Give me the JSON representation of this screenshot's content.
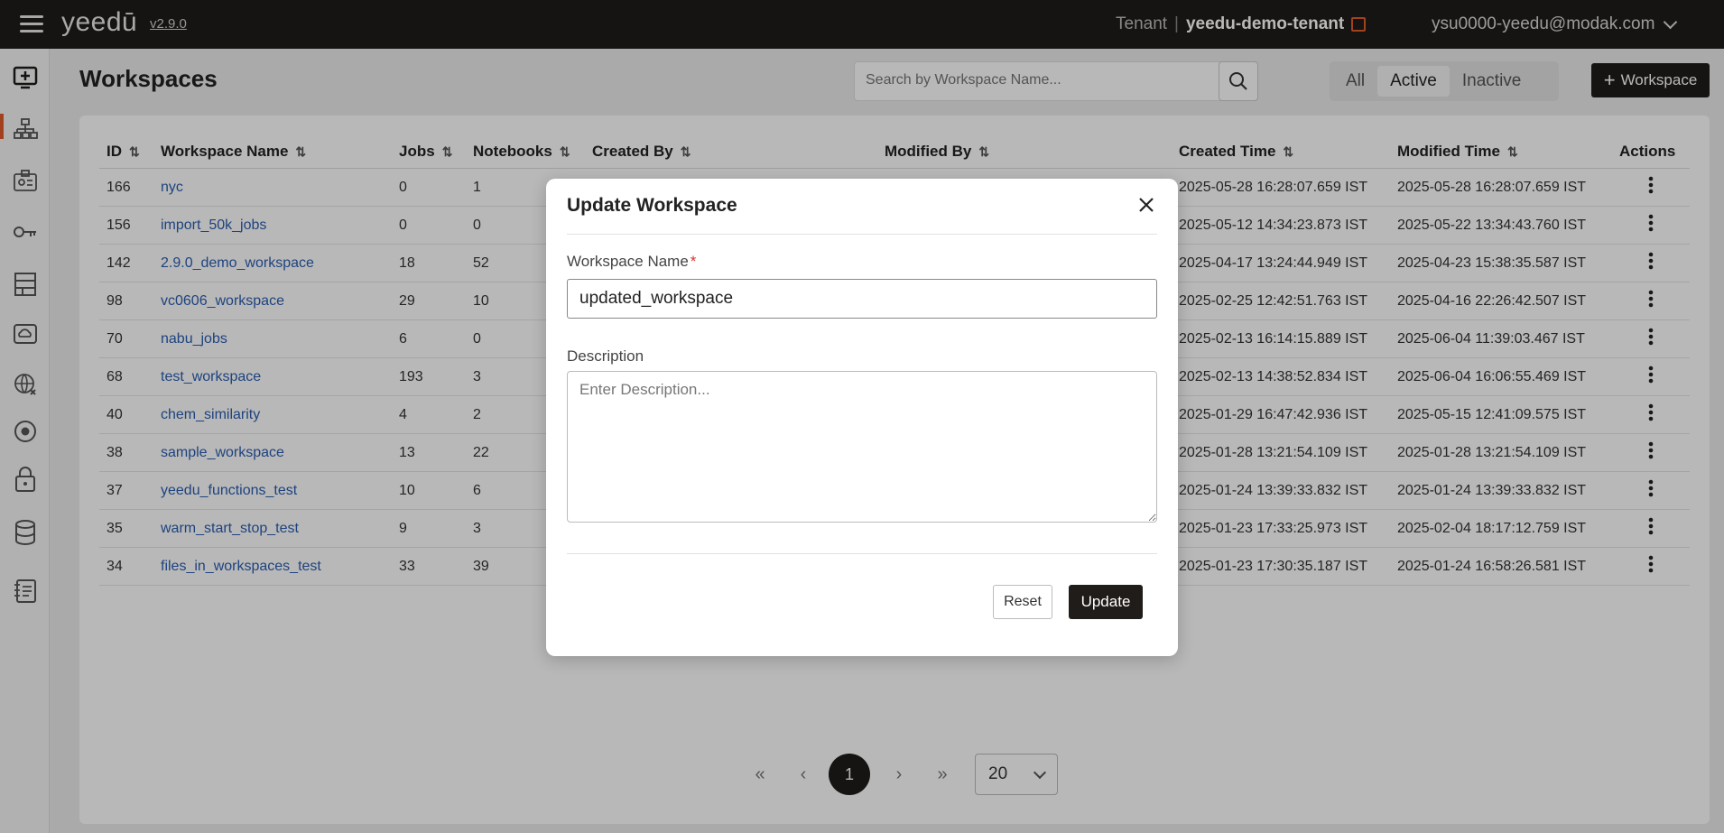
{
  "header": {
    "logo": "yeedū",
    "version": "v2.9.0",
    "tenant_label": "Tenant",
    "tenant_separator": "|",
    "tenant_name": "yeedu-demo-tenant",
    "user_email": "ysu0000-yeedu@modak.com"
  },
  "sidebar": {
    "icons": [
      "workspace-icon",
      "cluster-icon",
      "badge-icon",
      "key-icon",
      "building-icon",
      "cloud-icon",
      "globe-icon",
      "target-icon",
      "lock-icon",
      "database-icon",
      "notes-icon"
    ]
  },
  "page": {
    "title": "Workspaces",
    "search_placeholder": "Search by Workspace Name...",
    "filters": [
      "All",
      "Active",
      "Inactive"
    ],
    "active_filter": "Active",
    "add_button": "Workspace"
  },
  "table": {
    "columns": [
      "ID",
      "Workspace Name",
      "Jobs",
      "Notebooks",
      "Created By",
      "Modified By",
      "Created Time",
      "Modified Time",
      "Actions"
    ],
    "rows": [
      {
        "id": "166",
        "name": "nyc",
        "jobs": "0",
        "notebooks": "1",
        "created": "2025-05-28 16:28:07.659 IST",
        "modified": "2025-05-28 16:28:07.659 IST"
      },
      {
        "id": "156",
        "name": "import_50k_jobs",
        "jobs": "0",
        "notebooks": "0",
        "created": "2025-05-12 14:34:23.873 IST",
        "modified": "2025-05-22 13:34:43.760 IST"
      },
      {
        "id": "142",
        "name": "2.9.0_demo_workspace",
        "jobs": "18",
        "notebooks": "52",
        "created": "2025-04-17 13:24:44.949 IST",
        "modified": "2025-04-23 15:38:35.587 IST"
      },
      {
        "id": "98",
        "name": "vc0606_workspace",
        "jobs": "29",
        "notebooks": "10",
        "created": "2025-02-25 12:42:51.763 IST",
        "modified": "2025-04-16 22:26:42.507 IST"
      },
      {
        "id": "70",
        "name": "nabu_jobs",
        "jobs": "6",
        "notebooks": "0",
        "created": "2025-02-13 16:14:15.889 IST",
        "modified": "2025-06-04 11:39:03.467 IST"
      },
      {
        "id": "68",
        "name": "test_workspace",
        "jobs": "193",
        "notebooks": "3",
        "created": "2025-02-13 14:38:52.834 IST",
        "modified": "2025-06-04 16:06:55.469 IST"
      },
      {
        "id": "40",
        "name": "chem_similarity",
        "jobs": "4",
        "notebooks": "2",
        "created": "2025-01-29 16:47:42.936 IST",
        "modified": "2025-05-15 12:41:09.575 IST"
      },
      {
        "id": "38",
        "name": "sample_workspace",
        "jobs": "13",
        "notebooks": "22",
        "created": "2025-01-28 13:21:54.109 IST",
        "modified": "2025-01-28 13:21:54.109 IST"
      },
      {
        "id": "37",
        "name": "yeedu_functions_test",
        "jobs": "10",
        "notebooks": "6",
        "created": "2025-01-24 13:39:33.832 IST",
        "modified": "2025-01-24 13:39:33.832 IST"
      },
      {
        "id": "35",
        "name": "warm_start_stop_test",
        "jobs": "9",
        "notebooks": "3",
        "created": "2025-01-23 17:33:25.973 IST",
        "modified": "2025-02-04 18:17:12.759 IST"
      },
      {
        "id": "34",
        "name": "files_in_workspaces_test",
        "jobs": "33",
        "notebooks": "39",
        "created": "2025-01-23 17:30:35.187 IST",
        "modified": "2025-01-24 16:58:26.581 IST"
      }
    ]
  },
  "pagination": {
    "first": "«",
    "prev": "‹",
    "current": "1",
    "next": "›",
    "last": "»",
    "page_size": "20"
  },
  "modal": {
    "title": "Update Workspace",
    "name_label": "Workspace Name",
    "required_mark": "*",
    "name_value": "updated_workspace",
    "description_label": "Description",
    "description_placeholder": "Enter Description...",
    "reset_label": "Reset",
    "update_label": "Update"
  }
}
